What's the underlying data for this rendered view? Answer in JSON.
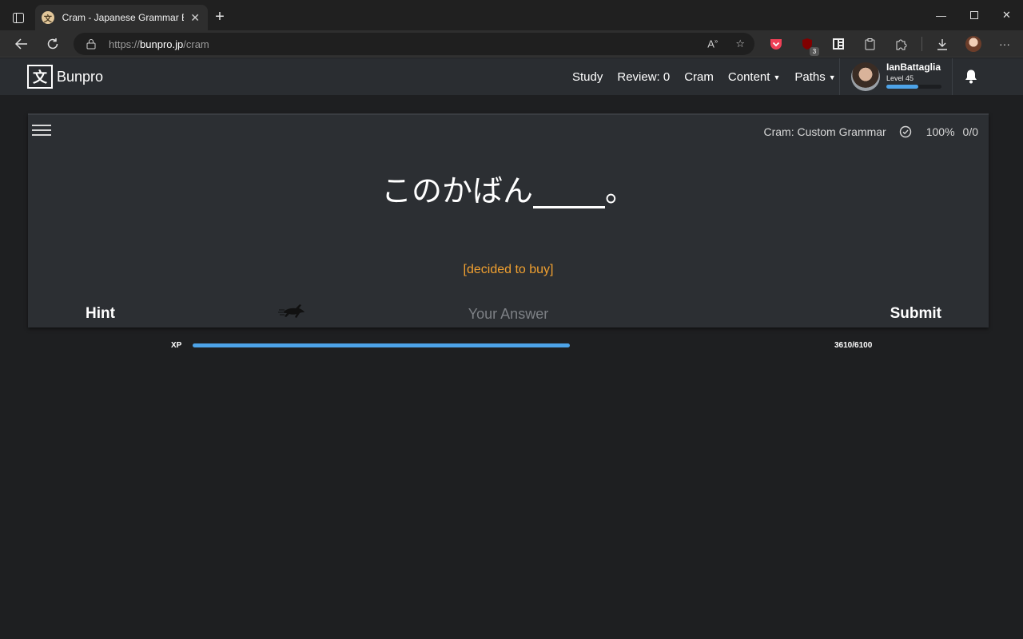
{
  "browser": {
    "tab_title": "Cram - Japanese Grammar Expla",
    "favicon_glyph": "文",
    "url_prefix": "https://",
    "url_host": "bunpro.jp",
    "url_path": "/cram",
    "extension_badge": "3"
  },
  "site": {
    "logo_glyph": "文",
    "logo_text": "Bunpro",
    "nav": {
      "study": "Study",
      "review": "Review: 0",
      "cram": "Cram",
      "content": "Content",
      "paths": "Paths"
    },
    "user": {
      "name": "IanBattaglia",
      "level": "Level 45",
      "level_progress": 0.58
    }
  },
  "cram": {
    "mode": "Cram: Custom Grammar",
    "accuracy": "100%",
    "count": "0/0",
    "sentence_before": "このかばん",
    "sentence_after": "。",
    "english_hint": "[decided to buy]",
    "hint_label": "Hint",
    "answer_placeholder": "Your Answer",
    "answer_value": "",
    "submit_label": "Submit"
  },
  "xp": {
    "label": "XP",
    "value_text": "3610/6100",
    "fill_fraction": 0.5918
  },
  "colors": {
    "accent_blue": "#4da3e8",
    "hint_orange": "#f0a030",
    "panel_bg": "#2c2f33",
    "header_bg": "#2a2d31",
    "page_bg": "#1e1f21"
  }
}
